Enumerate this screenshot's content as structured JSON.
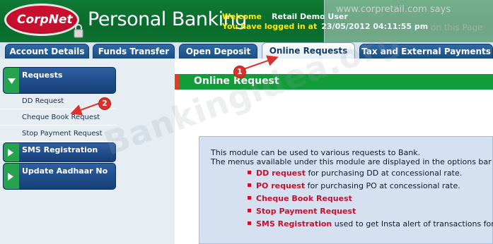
{
  "header": {
    "brand_logo_text": "CorpNet",
    "title": "Personal Banking",
    "welcome_label": "Welcome",
    "user_name": "Retail Demo User",
    "login_label": "You have logged in at",
    "login_time": "23/05/2012 04:11:55 pm"
  },
  "alert": {
    "title": "www.corpretail.com says",
    "message": "on this Page"
  },
  "tabs": [
    {
      "label": "Account Details"
    },
    {
      "label": "Funds Transfer"
    },
    {
      "label": "Open Deposit"
    },
    {
      "label": "Online Requests"
    },
    {
      "label": "Tax and External Payments"
    }
  ],
  "sidebar": {
    "requests_header": "Requests",
    "request_items": [
      {
        "label": "DD Request"
      },
      {
        "label": "Cheque Book Request"
      },
      {
        "label": "Stop Payment Request"
      }
    ],
    "sms_header": "SMS Registration",
    "aadhaar_header": "Update Aadhaar No"
  },
  "main": {
    "page_title": "Online Request",
    "intro_line1": "This module can be used to various requests to Bank.",
    "intro_line2": "The menus available under this module are displayed in the options bar",
    "options": [
      {
        "link": "DD request",
        "text": " for purchasing DD at concessional rate."
      },
      {
        "link": "PO request",
        "text": " for purchasing PO at concessional rate."
      },
      {
        "link": "Cheque Book Request",
        "text": ""
      },
      {
        "link": "Stop Payment Request",
        "text": ""
      },
      {
        "link": "SMS Registration",
        "text": " used to get Insta alert of transactions for"
      }
    ]
  },
  "watermark": "Bankingidea.org",
  "callouts": [
    {
      "number": "1"
    },
    {
      "number": "2"
    }
  ],
  "colors": {
    "header_green": "#0f7a35",
    "tab_blue": "#1b4f86",
    "title_bar_green": "#129c3a",
    "link_red": "#c8102e",
    "info_box_bg": "#d5e1f1"
  }
}
